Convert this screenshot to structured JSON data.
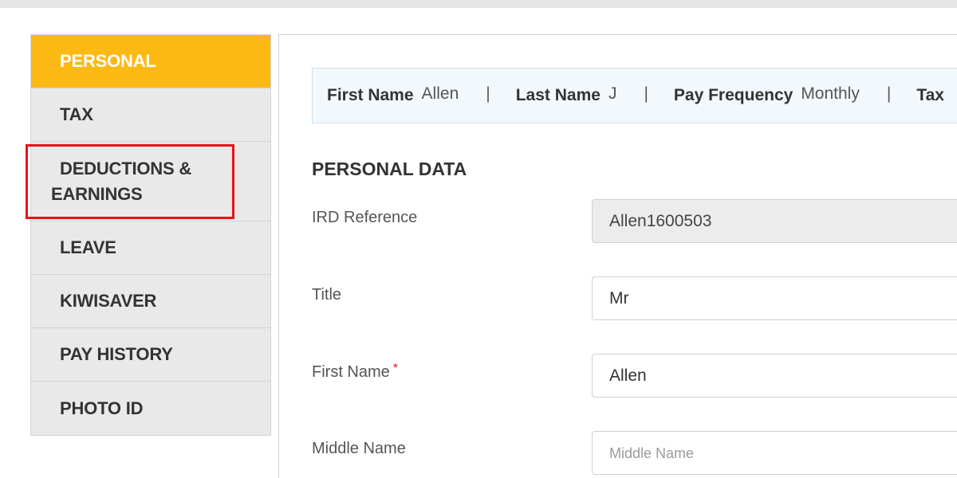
{
  "sidebar": {
    "items": [
      {
        "label": "PERSONAL"
      },
      {
        "label": "TAX"
      },
      {
        "label_line1": "DEDUCTIONS &",
        "label_line2": "EARNINGS"
      },
      {
        "label": "LEAVE"
      },
      {
        "label": "KIWISAVER"
      },
      {
        "label": "PAY HISTORY"
      },
      {
        "label": "PHOTO ID"
      }
    ]
  },
  "summary": {
    "first_name_label": "First Name",
    "first_name_value": "Allen",
    "last_name_label": "Last Name",
    "last_name_value": "J",
    "pay_frequency_label": "Pay Frequency",
    "pay_frequency_value": "Monthly",
    "truncated_label": "Tax",
    "separator": "|"
  },
  "form": {
    "section_title": "PERSONAL DATA",
    "ird": {
      "label": "IRD Reference",
      "value": "Allen1600503"
    },
    "title": {
      "label": "Title",
      "value": "Mr"
    },
    "first_name": {
      "label": "First Name",
      "required_mark": "*",
      "value": "Allen"
    },
    "middle_name": {
      "label": "Middle Name",
      "value": "",
      "placeholder": "Middle Name"
    }
  },
  "colors": {
    "accent": "#fdb913",
    "highlight": "#e8121a",
    "required": "#e8121a"
  }
}
